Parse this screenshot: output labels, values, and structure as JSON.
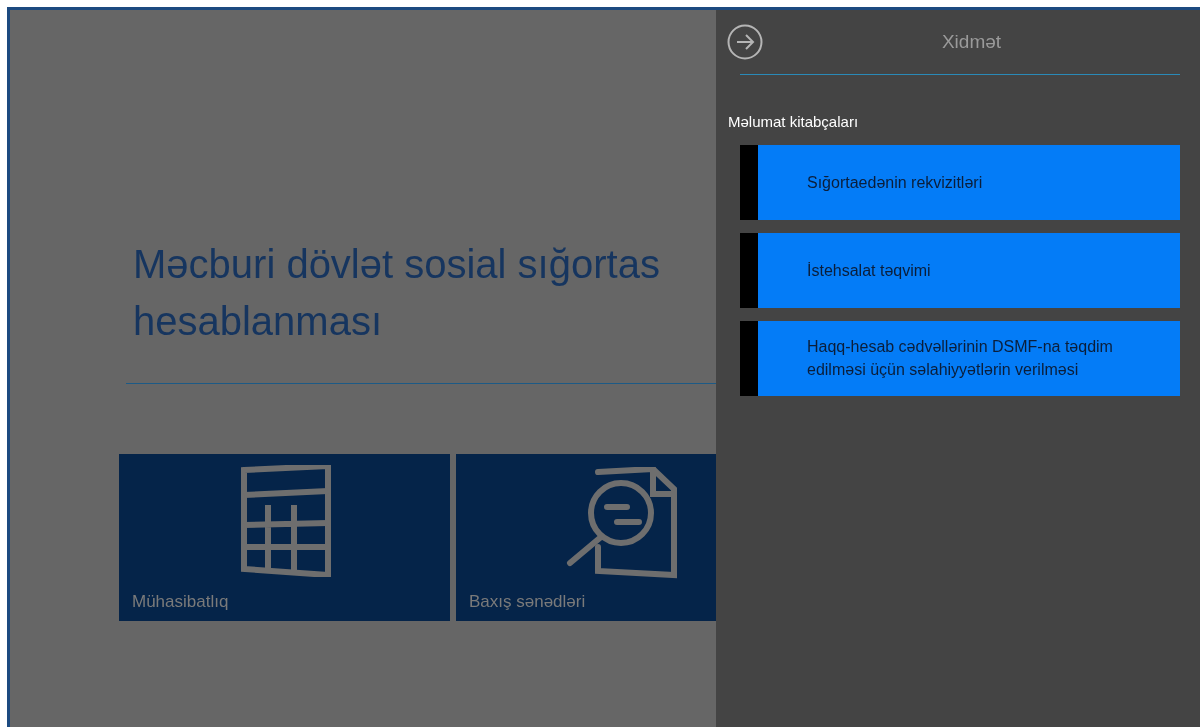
{
  "main": {
    "heading_lines": [
      "Məcburi dövlət sosial sığortas",
      "hesablanması"
    ],
    "tiles": [
      {
        "kind": "calculator",
        "label": "Mühasibatlıq"
      },
      {
        "kind": "document-search",
        "label": "Baxış sənədləri"
      }
    ]
  },
  "panel": {
    "title": "Xidmət",
    "section": "Məlumat kitabçaları",
    "items": [
      {
        "label": "Sığortaedənin rekvizitləri"
      },
      {
        "label": "İstehsalat təqvimi"
      },
      {
        "label": "Haqq-hesab cədvəllərinin DSMF-na təqdim edilməsi üçün səlahiyyətlərin verilməsi"
      }
    ]
  }
}
